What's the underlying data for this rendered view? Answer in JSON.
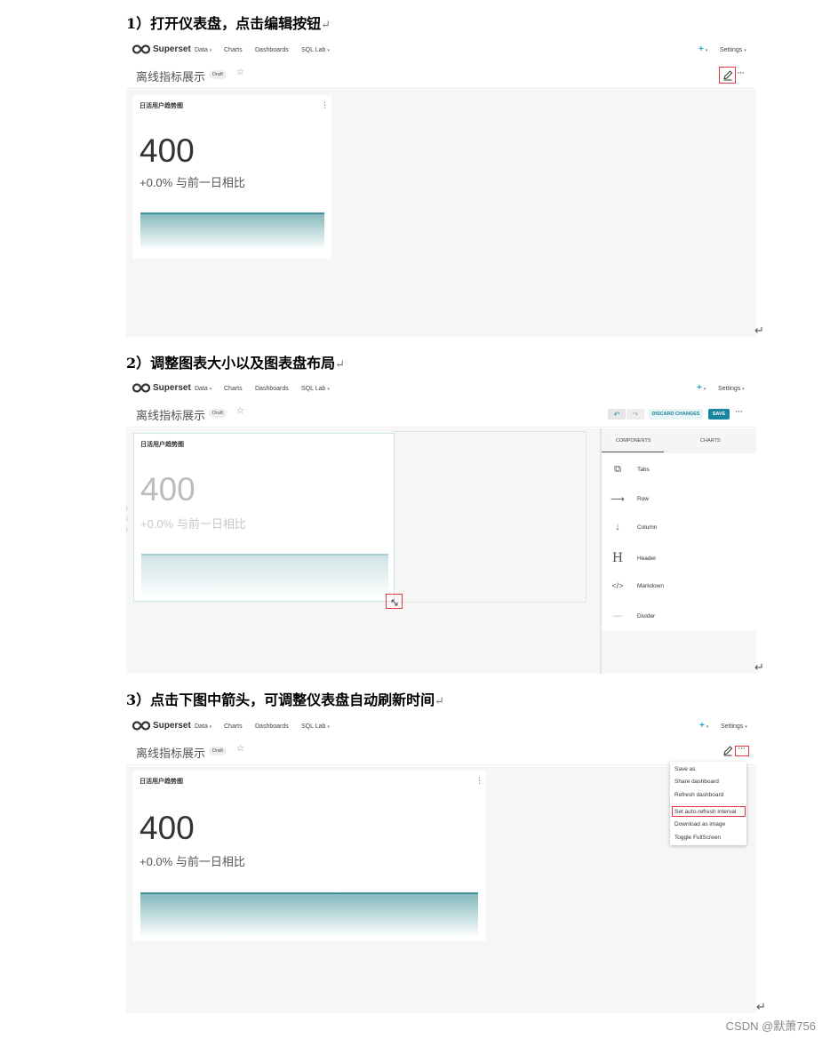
{
  "steps": [
    {
      "title": "1）打开仪表盘，点击编辑按钮"
    },
    {
      "title": "2）调整图表大小以及图表盘布局"
    },
    {
      "title": "3）点击下图中箭头，可调整仪表盘自动刷新时间"
    }
  ],
  "return_mark": "↵",
  "superset": {
    "brand": "Superset",
    "nav": [
      "Data",
      "Charts",
      "Dashboards",
      "SQL Lab"
    ],
    "plus": "+",
    "settings": "Settings",
    "dashboard_title": "离线指标展示",
    "draft_badge": "Draft",
    "star": "☆",
    "more": "···",
    "kebab": "⋮"
  },
  "chart": {
    "title": "日活用户趋势图",
    "big_number": "400",
    "subtitle": "+0.0% 与前一日相比"
  },
  "edit_toolbar": {
    "undo": "↶",
    "redo": "↷",
    "discard": "DISCARD CHANGES",
    "save": "SAVE"
  },
  "components_panel": {
    "tabs": [
      "COMPONENTS",
      "CHARTS"
    ],
    "items": [
      "Tabs",
      "Row",
      "Column",
      "Header",
      "Markdown",
      "Divider"
    ]
  },
  "more_menu": {
    "items": [
      "Save as",
      "Share dashboard",
      "Refresh dashboard",
      "Set auto-refresh interval",
      "Download as image",
      "Toggle FullScreen"
    ],
    "highlighted": "Set auto-refresh interval"
  },
  "watermark": "CSDN @默萧756",
  "colors": {
    "accent": "#20a7c9",
    "save_button": "#1a85a0",
    "highlight_box": "#e0383e",
    "chart_line": "#1f7f86"
  }
}
